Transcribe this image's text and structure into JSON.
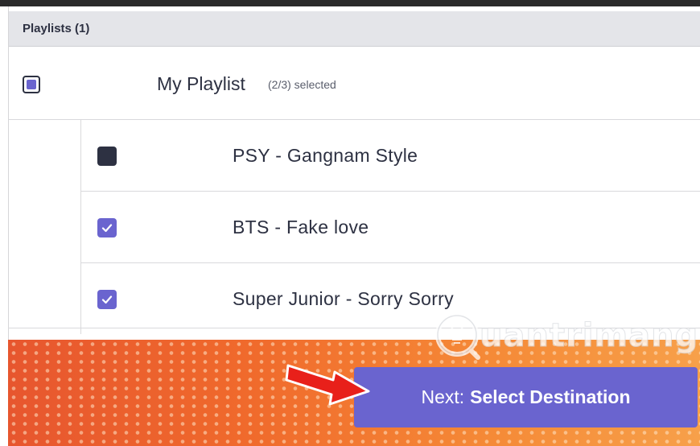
{
  "header": {
    "title": "Playlists (1)"
  },
  "playlist": {
    "name": "My Playlist",
    "selection_count": "(2/3) selected",
    "state": "partial"
  },
  "tracks": [
    {
      "name": "PSY - Gangnam Style",
      "checked": false
    },
    {
      "name": "BTS - Fake love",
      "checked": true
    },
    {
      "name": "Super Junior - Sorry Sorry",
      "checked": true
    }
  ],
  "next_button": {
    "prefix": "Next:",
    "label": "Select Destination"
  },
  "watermark": {
    "text": "uantrimang"
  },
  "colors": {
    "accent": "#6a64cf",
    "text": "#2d3142",
    "header_bg": "#e4e5e9",
    "arrow": "#e8201a"
  },
  "icons": {
    "check": "check-icon",
    "arrow": "red-arrow-icon",
    "watermark_logo": "lightbulb-logo-icon"
  }
}
